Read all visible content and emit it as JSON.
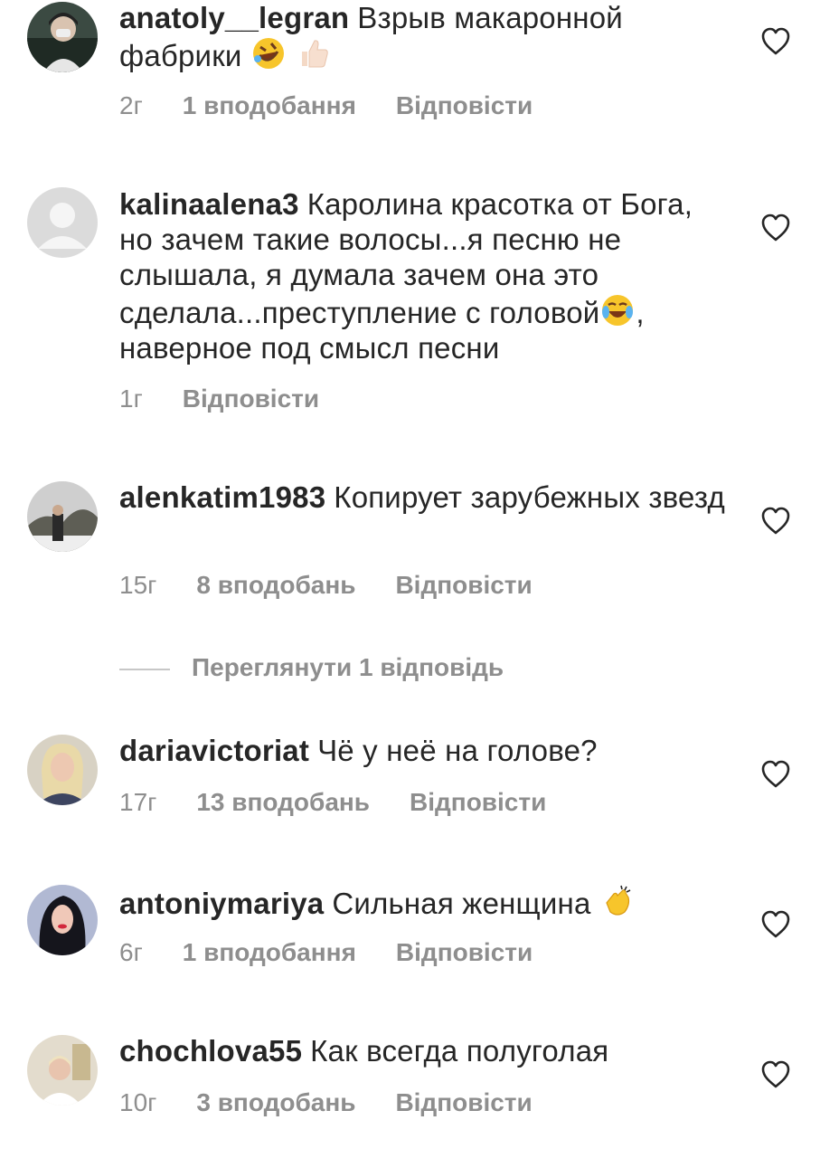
{
  "comments": [
    {
      "username": "anatoly__legran",
      "text": "Взрыв макаронной фабрики",
      "emojis": [
        "rolling-laughing-emoji",
        "thumbs-up-emoji"
      ],
      "time": "2г",
      "likes": "1 вподобання",
      "reply": "Відповісти"
    },
    {
      "username": "kalinaalena3",
      "text": "Каролина красотка от Бога, но зачем такие волосы...я песню не слышала, я думала зачем она это сделала...преступление с головой",
      "text_after": ", наверное под смысл песни",
      "emojis": [
        "tears-of-joy-emoji"
      ],
      "time": "1г",
      "reply": "Відповісти"
    },
    {
      "username": "alenkatim1983",
      "text": "Копирует зарубежных звезд",
      "time": "15г",
      "likes": "8 вподобань",
      "reply": "Відповісти"
    },
    {
      "username": "dariavictoriat",
      "text": "Чё у неё на голове?",
      "time": "17г",
      "likes": "13 вподобань",
      "reply": "Відповісти"
    },
    {
      "username": "antoniymariya",
      "text": "Сильная женщина",
      "emojis": [
        "clapping-hands-emoji"
      ],
      "time": "6г",
      "likes": "1 вподобання",
      "reply": "Відповісти"
    },
    {
      "username": "chochlova55",
      "text": "Как всегда полуголая",
      "time": "10г",
      "likes": "3 вподобань",
      "reply": "Відповісти"
    }
  ],
  "view_replies": "Переглянути 1 відповідь",
  "colors": {
    "text": "#262626",
    "meta": "#8e8e8e",
    "heart": "#262626"
  }
}
